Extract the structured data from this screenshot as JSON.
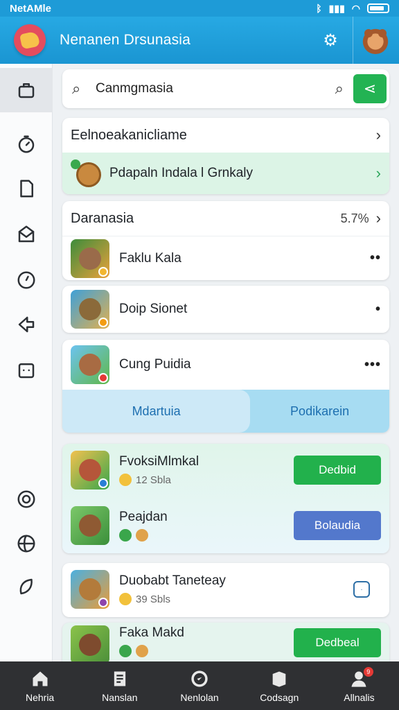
{
  "status_bar": {
    "carrier": "NetAMle",
    "icons": [
      "bluetooth-icon",
      "signal-icon",
      "wifi-icon",
      "battery-icon"
    ]
  },
  "app_bar": {
    "title": "Nenanen Drsunasia",
    "settings_icon": "gear-icon",
    "avatar": "user-avatar"
  },
  "sidebar": {
    "items": [
      "home-bag-icon",
      "timer-icon",
      "document-icon",
      "mail-icon",
      "compass-icon",
      "navigation-icon",
      "folder-icon",
      "target-icon",
      "globe-icon",
      "leaf-icon"
    ]
  },
  "search": {
    "value": "Canmgmasia"
  },
  "section1": {
    "title": "Eelnoeakanicliame",
    "promo": "Pdapaln Indala l Grnkaly"
  },
  "section2": {
    "title": "Daranasia",
    "percent": "5.7%",
    "game": "Faklu Kala"
  },
  "section3": {
    "game": "Doip Sionet"
  },
  "section4": {
    "game": "Cung Puidia",
    "seg_left": "Mdartuia",
    "seg_right": "Podikarein"
  },
  "apps": [
    {
      "name": "FvoksiMlmkal",
      "sub": "12 Sbla",
      "button": "Dedbid"
    },
    {
      "name": "Peajdan",
      "sub": "",
      "button": "Bolaudia"
    },
    {
      "name": "Duobabt Taneteay",
      "sub": "39 Sbls"
    },
    {
      "name": "Faka Makd",
      "button": "Dedbeal"
    }
  ],
  "bottom_nav": [
    {
      "label": "Nehria",
      "icon": "home-icon"
    },
    {
      "label": "Nanslan",
      "icon": "document-list-icon"
    },
    {
      "label": "Nenlolan",
      "icon": "check-circle-icon"
    },
    {
      "label": "Codsagn",
      "icon": "box-icon"
    },
    {
      "label": "Allnalis",
      "icon": "person-icon",
      "badge": "9"
    }
  ],
  "colors": {
    "primary": "#1e9bd7",
    "green": "#22b14c",
    "blue_button": "#5378cc",
    "nav_bg": "#2f3033"
  }
}
